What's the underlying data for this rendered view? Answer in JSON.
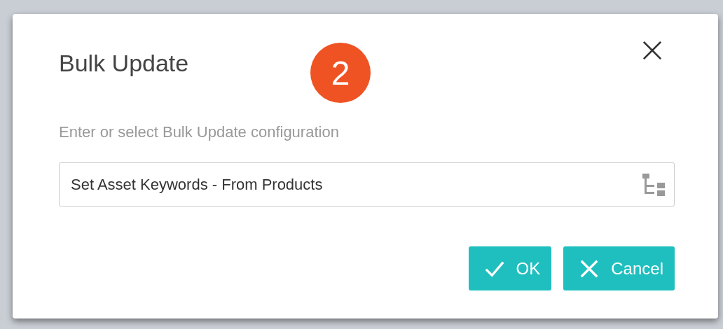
{
  "dialog": {
    "title": "Bulk Update",
    "step_badge": "2",
    "prompt": "Enter or select Bulk Update configuration",
    "field": {
      "value": "Set Asset Keywords - From Products"
    },
    "buttons": [
      {
        "label": "OK",
        "kind": "ok"
      },
      {
        "label": "Cancel",
        "kind": "cancel"
      }
    ]
  }
}
